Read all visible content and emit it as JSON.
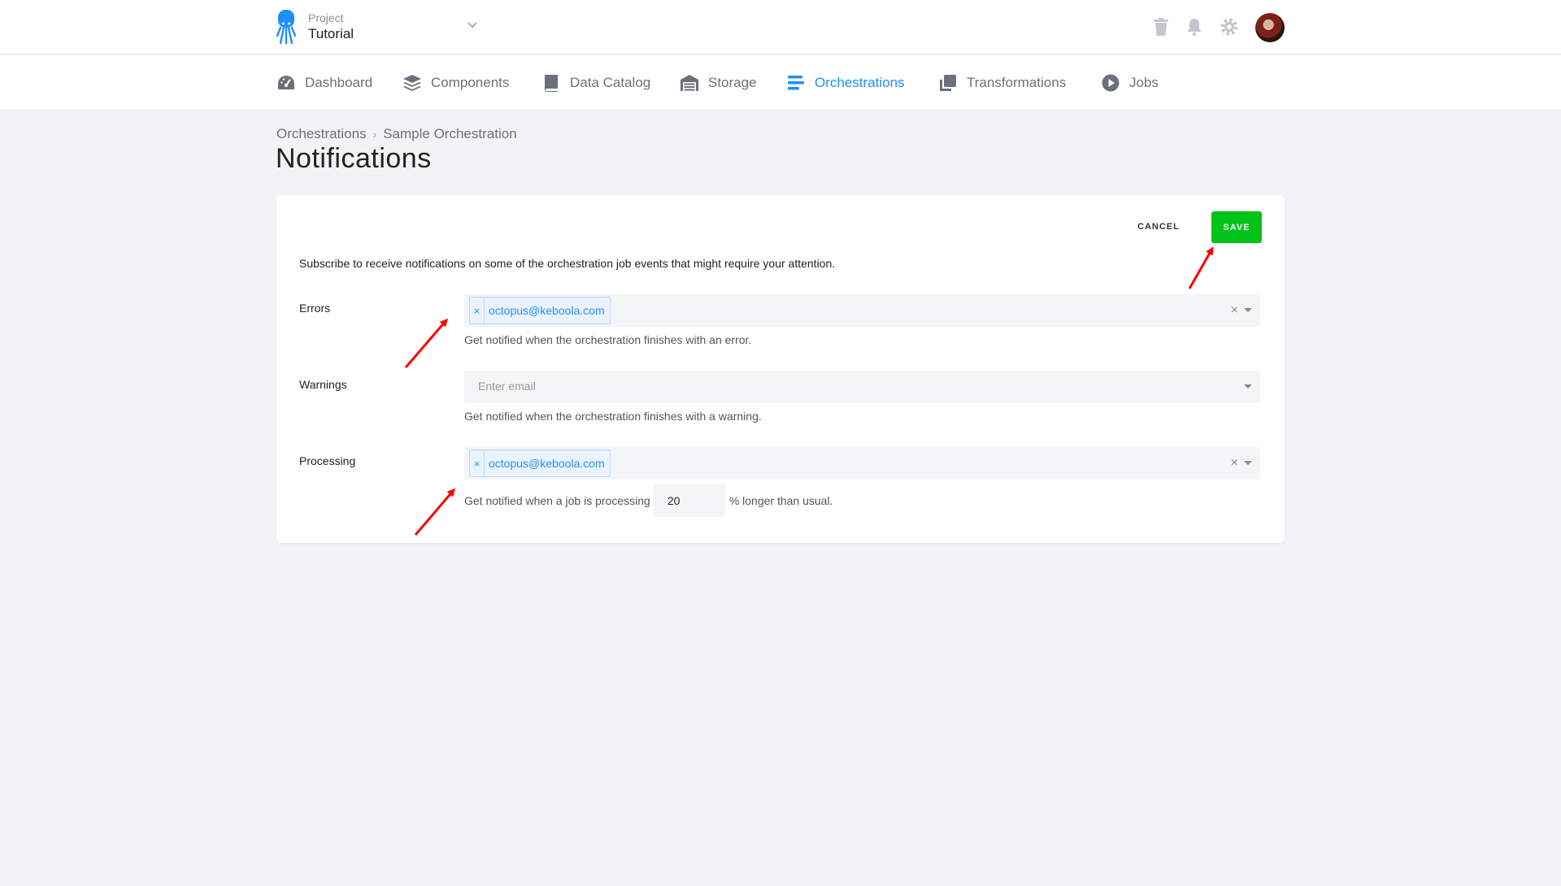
{
  "header": {
    "project_label": "Project",
    "project_name": "Tutorial",
    "brand_color": "#1f8fff"
  },
  "nav": {
    "items": [
      {
        "label": "Dashboard",
        "icon": "dashboard-gauge-icon"
      },
      {
        "label": "Components",
        "icon": "layers-icon"
      },
      {
        "label": "Data Catalog",
        "icon": "book-icon"
      },
      {
        "label": "Storage",
        "icon": "warehouse-icon"
      },
      {
        "label": "Orchestrations",
        "icon": "bars-icon",
        "active": true
      },
      {
        "label": "Transformations",
        "icon": "copy-icon"
      },
      {
        "label": "Jobs",
        "icon": "play-circle-icon"
      }
    ],
    "active_color": "#1f8fff"
  },
  "breadcrumb": {
    "parent": "Orchestrations",
    "separator": "›",
    "current": "Sample Orchestration"
  },
  "page": {
    "title": "Notifications"
  },
  "card": {
    "cancel_label": "CANCEL",
    "save_label": "SAVE",
    "save_color": "#00c217",
    "intro": "Subscribe to receive notifications on some of the orchestration job events that might require your attention.",
    "errors": {
      "label": "Errors",
      "tag": "octopus@keboola.com",
      "help": "Get notified when the orchestration finishes with an error."
    },
    "warnings": {
      "label": "Warnings",
      "placeholder": "Enter email",
      "help": "Get notified when the orchestration finishes with a warning."
    },
    "processing": {
      "label": "Processing",
      "tag": "octopus@keboola.com",
      "help_before": "Get notified when a job is processing",
      "value": "20",
      "help_after": "% longer than usual."
    }
  },
  "annotation_color": "#ff0000"
}
